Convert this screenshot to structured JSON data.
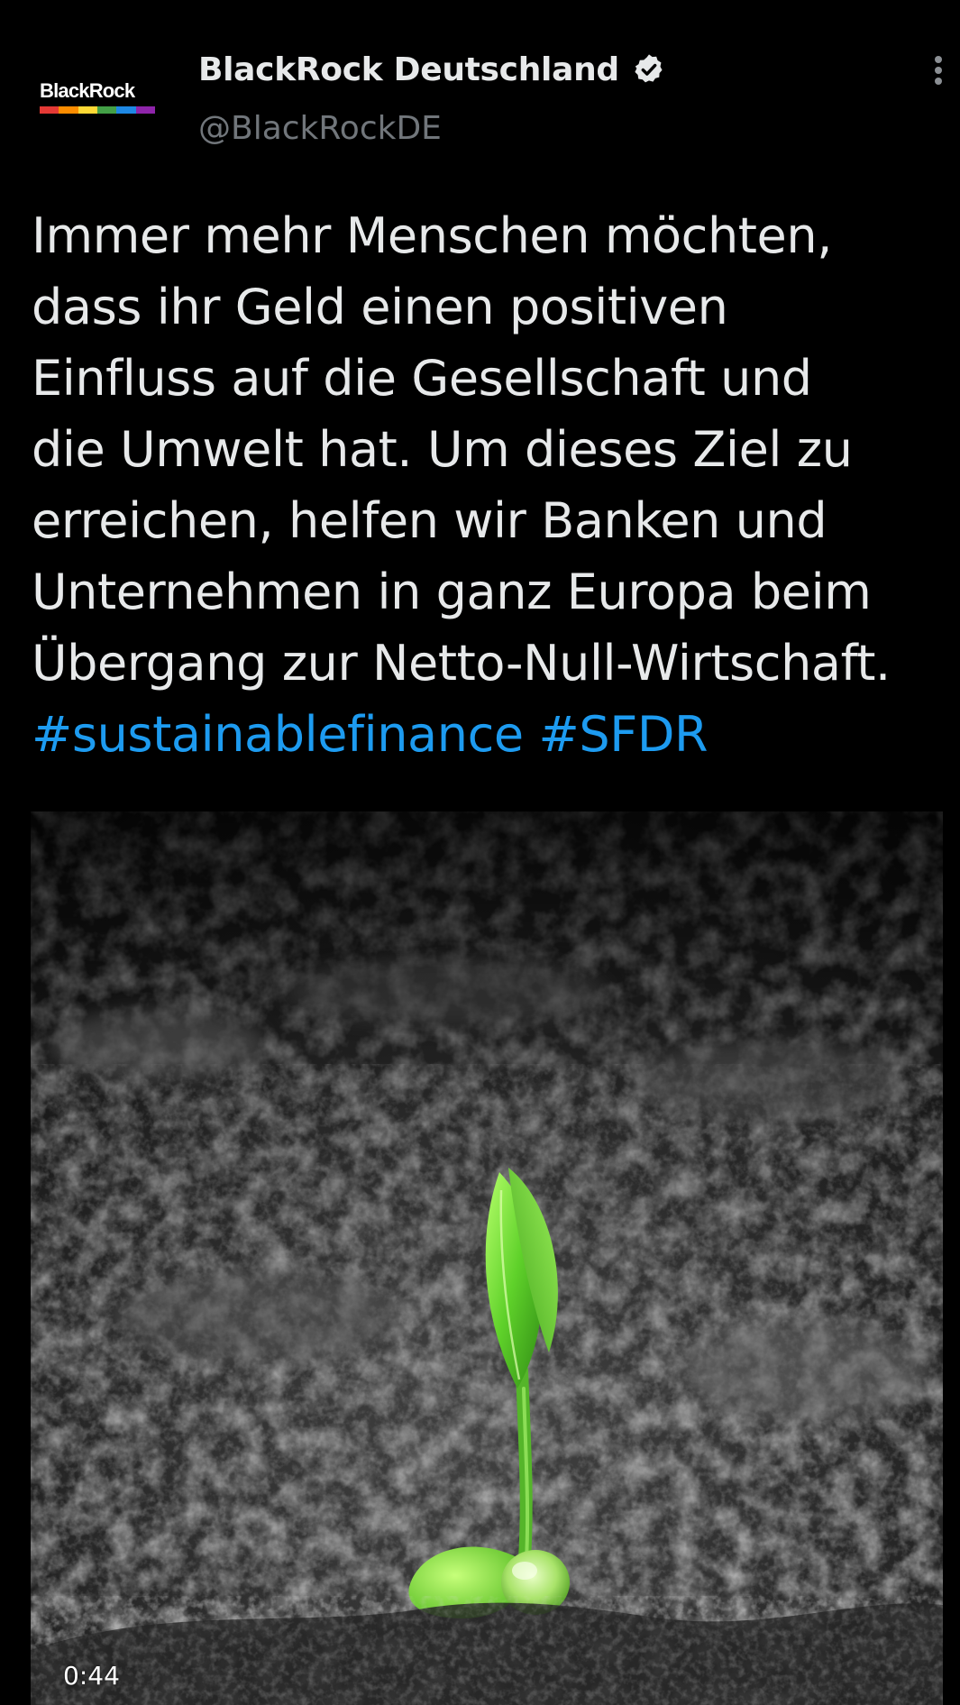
{
  "author": {
    "avatar_wordmark": "BlackRock",
    "avatar_stripe_colors": [
      "#e53935",
      "#fb8c00",
      "#fdd835",
      "#43a047",
      "#1e88e5",
      "#8e24aa"
    ],
    "display_name": "BlackRock Deutschland",
    "verified_icon": "verified-badge-icon",
    "handle": "@BlackRockDE"
  },
  "menu": {
    "icon": "more-vertical-icon"
  },
  "tweet": {
    "lines": [
      "Immer mehr Menschen möchten,",
      "dass ihr Geld einen positiven",
      "Einfluss auf die Gesellschaft und",
      "die Umwelt hat. Um dieses Ziel zu",
      "erreichen, helfen wir Banken und",
      "Unternehmen in ganz Europa beim",
      "Übergang zur Netto-Null-Wirtschaft."
    ],
    "hashtags": [
      "#sustainablefinance",
      "#SFDR"
    ]
  },
  "media": {
    "type": "video",
    "duration": "0:44"
  },
  "colors": {
    "background": "#000000",
    "text": "#e7e9ea",
    "muted": "#71767b",
    "link": "#1d9bf0"
  }
}
